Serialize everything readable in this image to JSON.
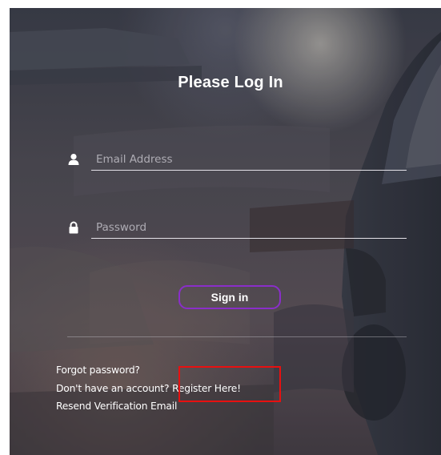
{
  "login": {
    "title": "Please Log In",
    "email_placeholder": "Email Address",
    "password_placeholder": "Password",
    "signin_label": "Sign in"
  },
  "links": {
    "forgot_password": "Forgot password?",
    "no_account_prefix": "Don't have an account?",
    "register": "Register Here!",
    "resend_verification": "Resend Verification Email"
  },
  "icons": {
    "email": "user-icon",
    "password": "lock-icon"
  },
  "colors": {
    "button_border": "#8a2ec9",
    "highlight": "#e81010"
  }
}
